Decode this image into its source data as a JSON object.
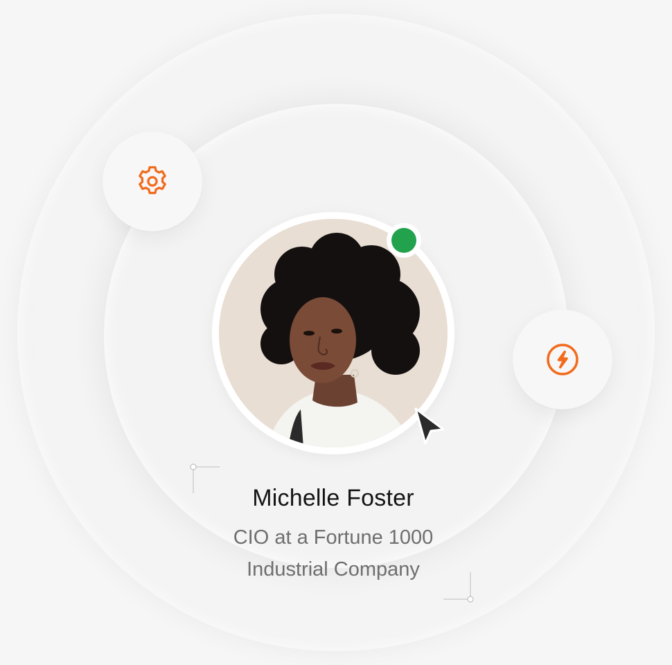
{
  "profile": {
    "name": "Michelle Foster",
    "title_line_1": "CIO at a Fortune 1000",
    "title_line_2": "Industrial Company",
    "status": "online"
  },
  "icons": {
    "settings": "gear-icon",
    "action": "lightning-bolt-icon",
    "pointer": "mouse-cursor-icon"
  },
  "colors": {
    "accent": "#f26b1d",
    "status_online": "#23a24d",
    "background": "#f6f6f6",
    "name_text": "#141414",
    "subtitle_text": "#6e6e6e"
  }
}
